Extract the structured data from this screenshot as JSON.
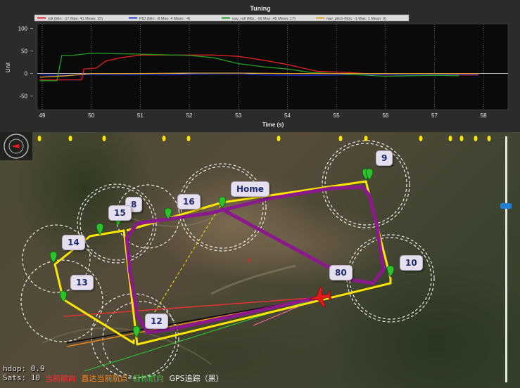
{
  "tuning": {
    "title": "Tuning",
    "y_axis_label": "Unit",
    "x_axis_label": "Time (s)",
    "legend": [
      {
        "label": "roll (Min: -17 Max: 41 Mean: 15)",
        "color": "#e02020"
      },
      {
        "label": "PID (Min: -8 Max: 4 Mean: -4)",
        "color": "#2030e0"
      },
      {
        "label": "nav_roll (Min: -16 Max: 45 Mean: 17)",
        "color": "#20a020"
      },
      {
        "label": "nav_pitch (Min: -1 Max: 1 Mean: 0)",
        "color": "#e0a020"
      }
    ]
  },
  "chart_data": {
    "type": "line",
    "title": "Tuning",
    "xlabel": "Time (s)",
    "ylabel": "Unit",
    "xlim": [
      48.9,
      58.5
    ],
    "ylim": [
      -80,
      110
    ],
    "xticks": [
      "49",
      "50",
      "51",
      "52",
      "53",
      "54",
      "55",
      "56",
      "57",
      "58"
    ],
    "yticks": [
      "100",
      "50",
      "0",
      "-50"
    ],
    "series": [
      {
        "name": "roll (Min: -17 Max: 41 Mean: 15)",
        "color": "#e02020",
        "points": [
          [
            48.95,
            -14
          ],
          [
            49.8,
            -14
          ],
          [
            49.85,
            10
          ],
          [
            50.1,
            12
          ],
          [
            50.3,
            28
          ],
          [
            50.6,
            35
          ],
          [
            51.0,
            41
          ],
          [
            52.5,
            41
          ],
          [
            53.0,
            38
          ],
          [
            53.6,
            28
          ],
          [
            54.0,
            20
          ],
          [
            54.6,
            5
          ],
          [
            55.3,
            2
          ],
          [
            56.0,
            -3
          ],
          [
            57.0,
            -3
          ],
          [
            57.9,
            -3
          ]
        ]
      },
      {
        "name": "PID (Min: -8 Max: 4 Mean: -4)",
        "color": "#2030e0",
        "points": [
          [
            48.95,
            -3
          ],
          [
            49.5,
            -4
          ],
          [
            50.0,
            -2
          ],
          [
            50.5,
            -3
          ],
          [
            51.0,
            -2
          ],
          [
            51.5,
            -3
          ],
          [
            52.0,
            -1
          ],
          [
            53.0,
            0
          ],
          [
            53.5,
            -3
          ],
          [
            54.5,
            -4
          ],
          [
            55.5,
            -2
          ],
          [
            56.5,
            -3
          ],
          [
            57.5,
            -2
          ],
          [
            57.9,
            -2
          ]
        ]
      },
      {
        "name": "nav_roll (Min: -16 Max: 45 Mean: 17)",
        "color": "#20a020",
        "points": [
          [
            48.95,
            -16
          ],
          [
            49.3,
            -16
          ],
          [
            49.4,
            40
          ],
          [
            49.6,
            40
          ],
          [
            50.0,
            45
          ],
          [
            51.0,
            43
          ],
          [
            52.0,
            40
          ],
          [
            52.5,
            35
          ],
          [
            53.0,
            22
          ],
          [
            53.5,
            15
          ],
          [
            54.0,
            10
          ],
          [
            54.5,
            2
          ],
          [
            55.0,
            0
          ],
          [
            55.5,
            -3
          ],
          [
            56.0,
            -6
          ],
          [
            57.0,
            -4
          ],
          [
            57.5,
            -5
          ]
        ]
      },
      {
        "name": "nav_pitch (Min: -1 Max: 1 Mean: 0)",
        "color": "#e0a020",
        "points": [
          [
            48.95,
            -8
          ],
          [
            49.5,
            -5
          ],
          [
            50.0,
            0
          ],
          [
            51.0,
            0
          ],
          [
            52.0,
            1
          ],
          [
            53.0,
            1
          ],
          [
            54.0,
            0
          ],
          [
            55.0,
            0
          ],
          [
            56.0,
            0
          ],
          [
            57.0,
            0
          ],
          [
            57.9,
            0
          ]
        ]
      }
    ]
  },
  "map": {
    "waypoints": [
      {
        "label": "Home"
      },
      {
        "label": "9"
      },
      {
        "label": "8"
      },
      {
        "label": "15"
      },
      {
        "label": "16"
      },
      {
        "label": "14"
      },
      {
        "label": "13"
      },
      {
        "label": "12"
      },
      {
        "label": "10"
      },
      {
        "label": "80"
      }
    ],
    "telemetry": {
      "hdop_label": "hdop:",
      "hdop_value": "0.9",
      "sats_label": "Sats:",
      "sats_value": "10"
    },
    "legend": [
      {
        "text": "当前航向",
        "color": "#ff3030"
      },
      {
        "text": "直达当前航点",
        "color": "#ff8a1a"
      },
      {
        "text": "目标航向",
        "color": "#30c030"
      },
      {
        "text": "GPS追踪（黑）",
        "color": "#f0f0f0"
      }
    ],
    "colors": {
      "mission": "#ffe600",
      "track": "#8a1a8c",
      "radius": "#ffffff",
      "marker": "#2dc22d",
      "plane": "#e01c1c"
    },
    "zoom_fraction": 0.27
  }
}
